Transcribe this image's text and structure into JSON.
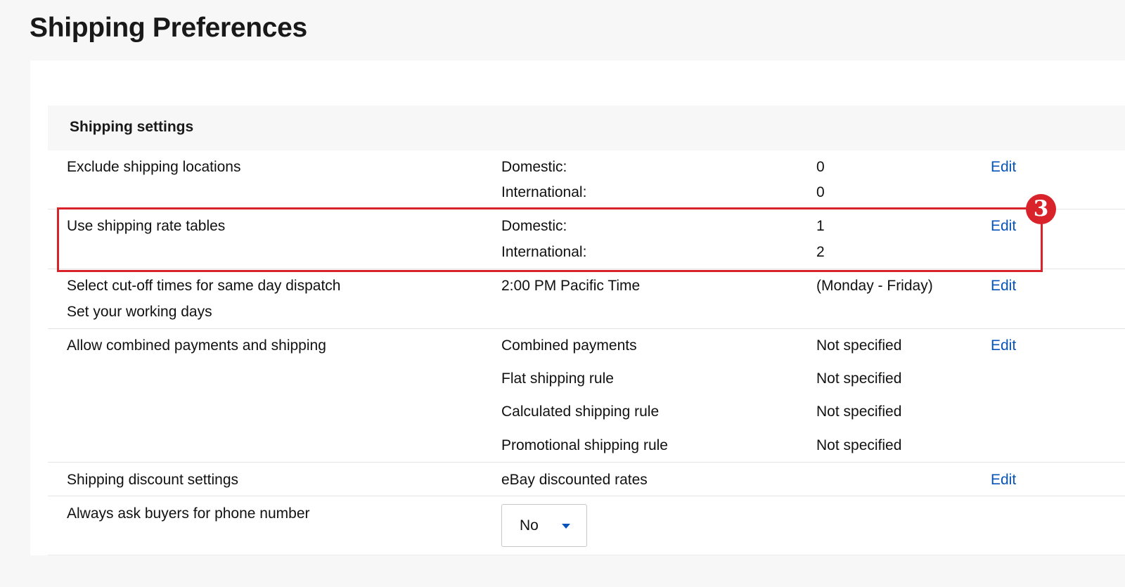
{
  "page": {
    "title": "Shipping Preferences"
  },
  "section": {
    "title": "Shipping settings"
  },
  "rows": {
    "exclude": {
      "label": "Exclude shipping locations",
      "domestic_label": "Domestic:",
      "domestic_value": "0",
      "international_label": "International:",
      "international_value": "0",
      "action": "Edit"
    },
    "rate_tables": {
      "label": "Use shipping rate tables",
      "domestic_label": "Domestic:",
      "domestic_value": "1",
      "international_label": "International:",
      "international_value": "2",
      "action": "Edit",
      "step_badge": "3"
    },
    "cutoff": {
      "label": "Select cut-off times for same day dispatch",
      "sublabel": "Set your working days",
      "value": "2:00 PM Pacific Time",
      "detail": "(Monday - Friday)",
      "action": "Edit"
    },
    "combined": {
      "label": "Allow combined payments and shipping",
      "items": [
        {
          "name": "Combined payments",
          "value": "Not specified"
        },
        {
          "name": "Flat shipping rule",
          "value": "Not specified"
        },
        {
          "name": "Calculated shipping rule",
          "value": "Not specified"
        },
        {
          "name": "Promotional shipping rule",
          "value": "Not specified"
        }
      ],
      "action": "Edit"
    },
    "discount": {
      "label": "Shipping discount settings",
      "value": "eBay discounted rates",
      "action": "Edit"
    },
    "phone": {
      "label": "Always ask buyers for phone number",
      "select_value": "No"
    }
  },
  "colors": {
    "link": "#0654ba",
    "highlight": "#d8232a"
  },
  "icons": {
    "dropdown": "caret-down-icon"
  }
}
